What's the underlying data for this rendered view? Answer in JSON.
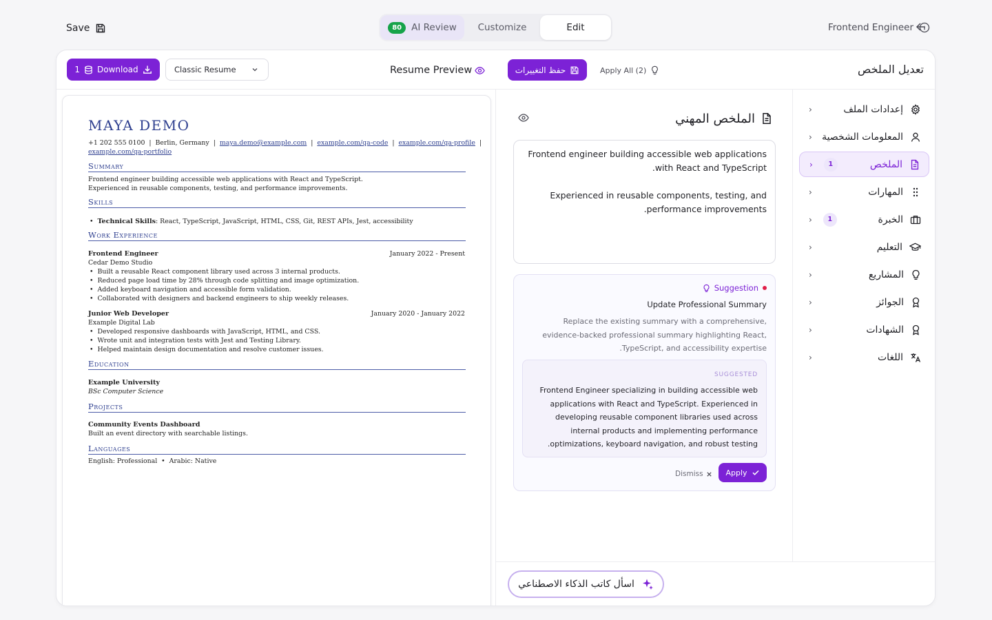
{
  "topbar": {
    "save_label": "Save",
    "tabs": {
      "ai_score": "80",
      "ai_review": "AI Review",
      "customize": "Customize",
      "edit": "Edit"
    },
    "job_title": "Frontend Engineer"
  },
  "preview": {
    "download_count": "1",
    "download_label": "Download",
    "template": "Classic Resume",
    "title": "Resume Preview"
  },
  "editor": {
    "save_changes": "حفظ التغييرات",
    "apply_all": "Apply All (2)",
    "title": "تعديل الملخص",
    "section_title": "الملخص المهني",
    "summary_lines": [
      "Frontend engineer building accessible web applications with React and TypeScript.",
      "Experienced in reusable components, testing, and performance improvements."
    ],
    "suggestion": {
      "label": "Suggestion",
      "title": "Update Professional Summary",
      "description": "Replace the existing summary with a comprehensive, evidence-backed professional summary highlighting React, TypeScript, and accessibility expertise.",
      "suggested_label": "SUGGESTED",
      "suggested_text": "Frontend Engineer specializing in building accessible web applications with React and TypeScript. Experienced in developing reusable component libraries used across internal products and implementing performance optimizations, keyboard navigation, and robust testing.",
      "dismiss": "Dismiss",
      "apply": "Apply"
    },
    "ask_ai": "اسأل كاتب الذكاء الاصطناعي"
  },
  "nav": [
    {
      "label": "إعدادات الملف",
      "icon": "gear-icon",
      "badge": ""
    },
    {
      "label": "المعلومات الشخصية",
      "icon": "user-icon",
      "badge": ""
    },
    {
      "label": "الملخص",
      "icon": "document-icon",
      "badge": "1",
      "active": true
    },
    {
      "label": "المهارات",
      "icon": "grid-dots-icon",
      "badge": ""
    },
    {
      "label": "الخبرة",
      "icon": "briefcase-icon",
      "badge": "1"
    },
    {
      "label": "التعليم",
      "icon": "graduation-cap-icon",
      "badge": ""
    },
    {
      "label": "المشاريع",
      "icon": "lightbulb-icon",
      "badge": ""
    },
    {
      "label": "الجوائز",
      "icon": "award-icon",
      "badge": ""
    },
    {
      "label": "الشهادات",
      "icon": "certificate-icon",
      "badge": ""
    },
    {
      "label": "اللغات",
      "icon": "translate-icon",
      "badge": ""
    }
  ],
  "resume": {
    "name": "MAYA DEMO",
    "phone": "+1 202 555 0100",
    "location": "Berlin, Germany",
    "email": "maya.demo@example.com",
    "link1": "example.com/qa-code",
    "link2": "example.com/qa-profile",
    "link3": "example.com/qa-portfolio",
    "sections": {
      "summary": "Summary",
      "skills": "Skills",
      "experience": "Work Experience",
      "education": "Education",
      "projects": "Projects",
      "languages": "Languages"
    },
    "summary_lines": [
      "Frontend engineer building accessible web applications with React and TypeScript.",
      "Experienced in reusable components, testing, and performance improvements."
    ],
    "skills_label": "Technical Skills",
    "skills_value": ": React, TypeScript, JavaScript, HTML, CSS, Git, REST APIs, Jest, accessibility",
    "jobs": [
      {
        "title": "Frontend Engineer",
        "dates": "January 2022 - Present",
        "company": "Cedar Demo Studio",
        "bullets": [
          "Built a reusable React component library used across 3 internal products.",
          "Reduced page load time by 28% through code splitting and image optimization.",
          "Added keyboard navigation and accessible form validation.",
          "Collaborated with designers and backend engineers to ship weekly releases."
        ]
      },
      {
        "title": "Junior Web Developer",
        "dates": "January 2020 - January 2022",
        "company": "Example Digital Lab",
        "bullets": [
          "Developed responsive dashboards with JavaScript, HTML, and CSS.",
          "Wrote unit and integration tests with Jest and Testing Library.",
          "Helped maintain design documentation and resolve customer issues."
        ]
      }
    ],
    "education": {
      "school": "Example University",
      "degree": "BSc Computer Science"
    },
    "project": {
      "name": "Community Events Dashboard",
      "desc": "Built an event directory with searchable listings."
    },
    "languages_line": "English: Professional  •  Arabic: Native"
  },
  "colors": {
    "accent": "#7c22d6",
    "resume_heading": "#2e3f8f",
    "score_badge": "#16a34a"
  }
}
